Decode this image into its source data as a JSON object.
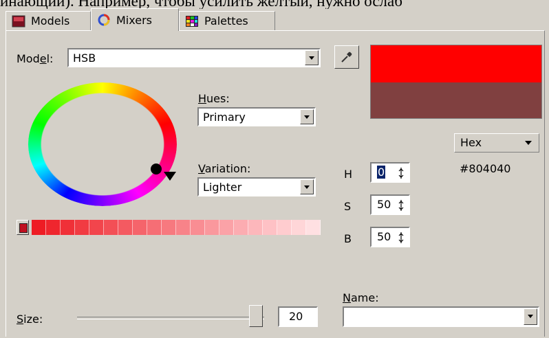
{
  "cut_text": "инающий). Например, чтобы усилить желтый, нужно ослаб",
  "tabs": [
    {
      "label": "Models",
      "icon": "models-icon"
    },
    {
      "label": "Mixers",
      "icon": "mixers-icon"
    },
    {
      "label": "Palettes",
      "icon": "palettes-icon"
    }
  ],
  "active_tab": "Mixers",
  "model": {
    "label_pre": "Mod",
    "label_accel": "e",
    "label_post": "l:",
    "value": "HSB"
  },
  "hues": {
    "label_accel": "H",
    "label_post": "ues:",
    "value": "Primary"
  },
  "variation": {
    "label_accel": "V",
    "label_post": "ariation:",
    "value": "Lighter"
  },
  "preview": {
    "new_color": "#ff0000",
    "old_color": "#804040"
  },
  "format": {
    "value": "Hex",
    "color_code": "#804040"
  },
  "hsb": [
    {
      "label": "H",
      "value": "0"
    },
    {
      "label": "S",
      "value": "50"
    },
    {
      "label": "B",
      "value": "50"
    }
  ],
  "name": {
    "label_accel": "N",
    "label_post": "ame:",
    "value": ""
  },
  "size": {
    "label_accel": "S",
    "label_post": "ize:",
    "value": "20"
  },
  "swatches": [
    "#ee1c24",
    "#ef262e",
    "#f03038",
    "#f13b42",
    "#f2454c",
    "#f34f56",
    "#f45a61",
    "#f5646b",
    "#f66e75",
    "#f7797f",
    "#f88389",
    "#f98d93",
    "#fa989d",
    "#fba2a7",
    "#fcacb1",
    "#fdb7bb",
    "#fec1c5",
    "#ffcccf",
    "#ffd6d8",
    "#ffe0e2"
  ]
}
